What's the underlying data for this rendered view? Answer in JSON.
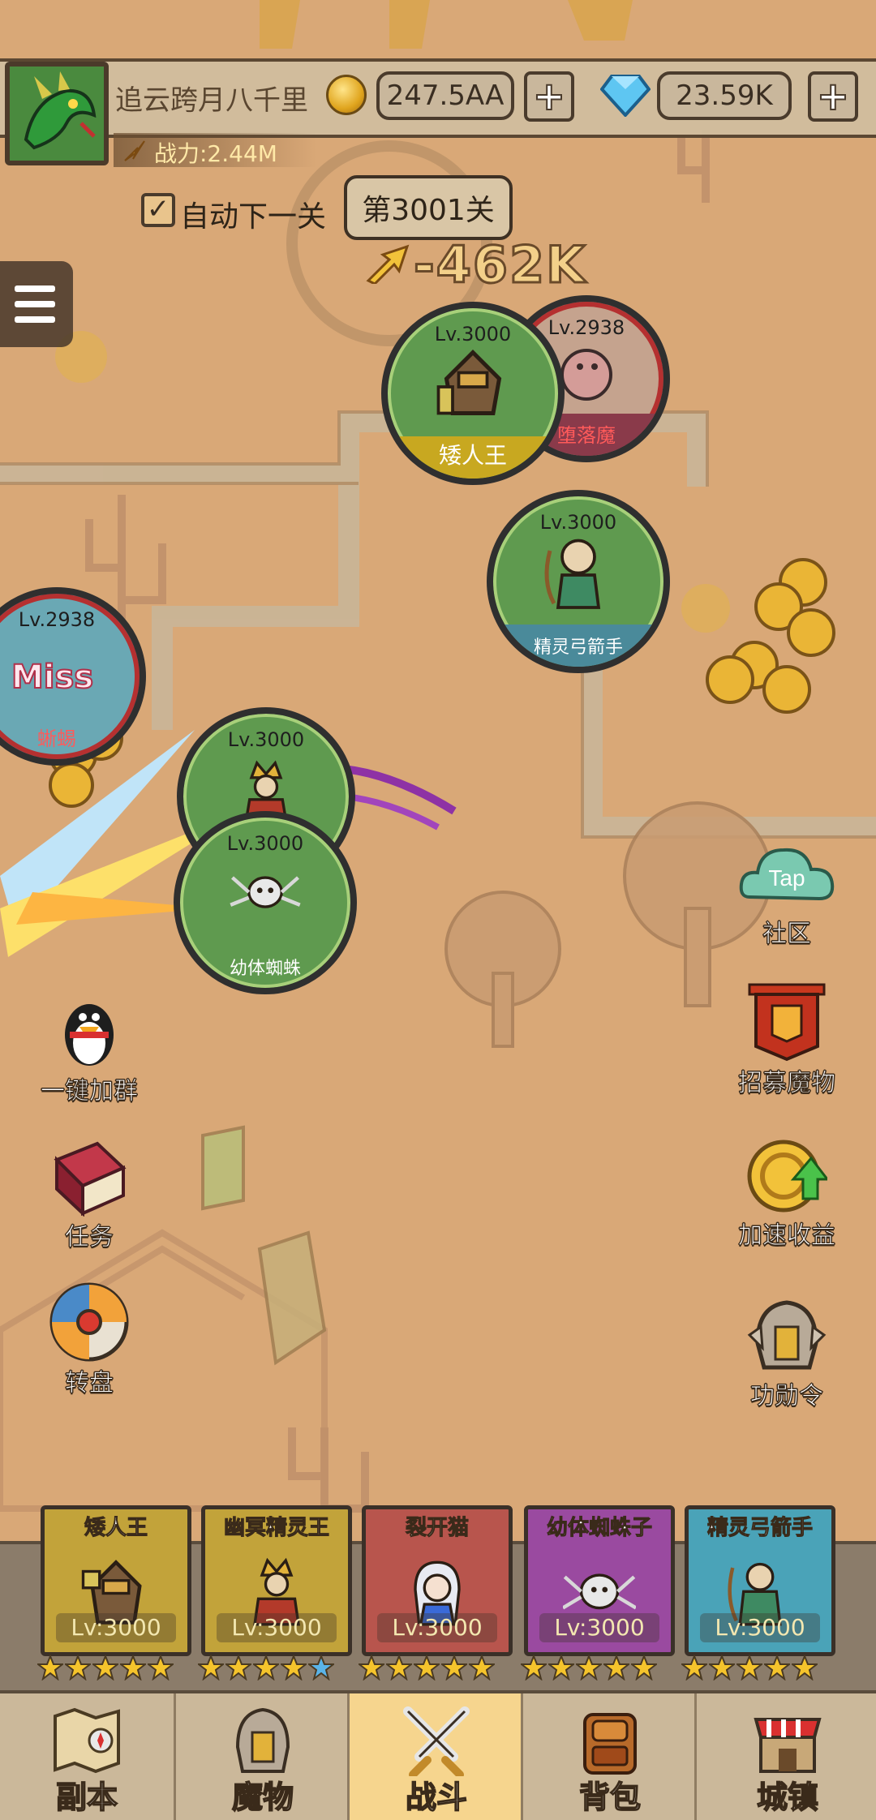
{
  "player": {
    "name": "追云跨月八千里",
    "gold": "247.5AA",
    "diamonds": "23.59K",
    "power": "战力:2.44M",
    "avatar_icon": "dragon-avatar-icon"
  },
  "stage": {
    "auto_next_label": "自动下一关",
    "auto_next_checked": true,
    "current_stage": "第3001关",
    "damage_number": "-462K"
  },
  "battle": {
    "monsters": [
      {
        "level": "Lv.3000",
        "name": "矮人王",
        "side": "hero"
      },
      {
        "level": "Lv.2938",
        "name": "堕落魔",
        "side": "enemy"
      },
      {
        "level": "Lv.3000",
        "name": "精灵弓箭手",
        "side": "hero"
      },
      {
        "level": "Lv.2938",
        "name": "蜥蜴",
        "side": "enemy"
      },
      {
        "level": "Lv.3000",
        "name": "",
        "side": "hero"
      },
      {
        "level": "Lv.3000",
        "name": "幼体蜘蛛",
        "side": "hero"
      }
    ],
    "miss_text": "Miss"
  },
  "side_buttons": {
    "left": [
      {
        "label": "一键加群",
        "icon": "penguin-icon"
      },
      {
        "label": "任务",
        "icon": "book-icon"
      },
      {
        "label": "转盘",
        "icon": "wheel-icon"
      }
    ],
    "right": [
      {
        "label": "社区",
        "icon": "tap-cloud-icon",
        "badge": "Tap"
      },
      {
        "label": "招募魔物",
        "icon": "banner-icon"
      },
      {
        "label": "加速收益",
        "icon": "coin-boost-icon"
      },
      {
        "label": "功勋令",
        "icon": "helmet-icon"
      }
    ]
  },
  "team": [
    {
      "name": "矮人王",
      "level": "Lv:3000",
      "stars": 5,
      "color": "#c2a33a"
    },
    {
      "name": "幽冥精灵王",
      "level": "Lv:3000",
      "stars": 4,
      "color": "#c2a33a"
    },
    {
      "name": "裂开猫",
      "level": "Lv:3000",
      "stars": 5,
      "color": "#b8554d"
    },
    {
      "name": "幼体蜘蛛子",
      "level": "Lv:3000",
      "stars": 5,
      "color": "#9a4aa0"
    },
    {
      "name": "精灵弓箭手",
      "level": "Lv:3000",
      "stars": 5,
      "color": "#4aa3b8"
    }
  ],
  "nav": [
    {
      "label": "副本",
      "icon": "map-icon",
      "active": false
    },
    {
      "label": "魔物",
      "icon": "monster-helmet-icon",
      "active": false
    },
    {
      "label": "战斗",
      "icon": "crossed-swords-icon",
      "active": true
    },
    {
      "label": "背包",
      "icon": "backpack-icon",
      "active": false
    },
    {
      "label": "城镇",
      "icon": "shop-icon",
      "active": false
    }
  ],
  "colors": {
    "ground": "#d9a877",
    "hero_ring": "#5f9a4f",
    "enemy_ring": "#b53030",
    "nav_active": "#f6d58e"
  }
}
